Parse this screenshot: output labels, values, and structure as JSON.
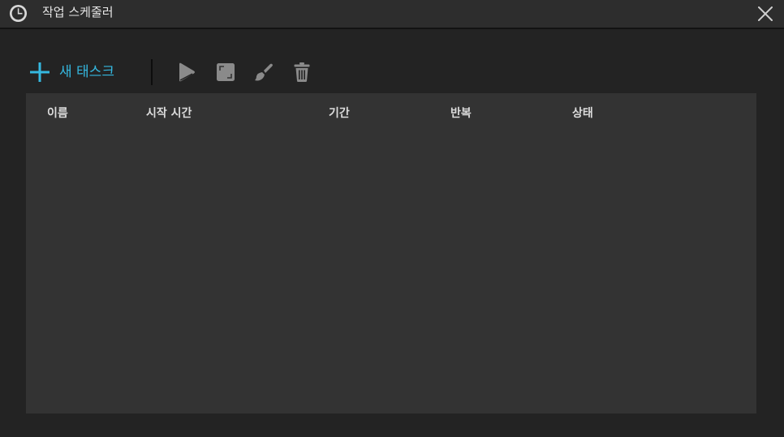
{
  "window": {
    "title": "작업 스케줄러"
  },
  "toolbar": {
    "new_task_label": "새 태스크"
  },
  "table": {
    "columns": [
      "이름",
      "시작 시간",
      "기간",
      "반복",
      "상태"
    ],
    "rows": []
  },
  "colors": {
    "accent": "#35b8e0",
    "background": "#232323",
    "titlebar": "#2d2d2d",
    "table_background": "#333333",
    "disabled_icon": "#8a8a8a"
  },
  "icons": {
    "app": "clock-icon",
    "close": "close-icon",
    "new_task": "plus-icon",
    "run": "play-icon",
    "stop": "stop-icon",
    "edit": "brush-icon",
    "delete": "trash-icon"
  }
}
